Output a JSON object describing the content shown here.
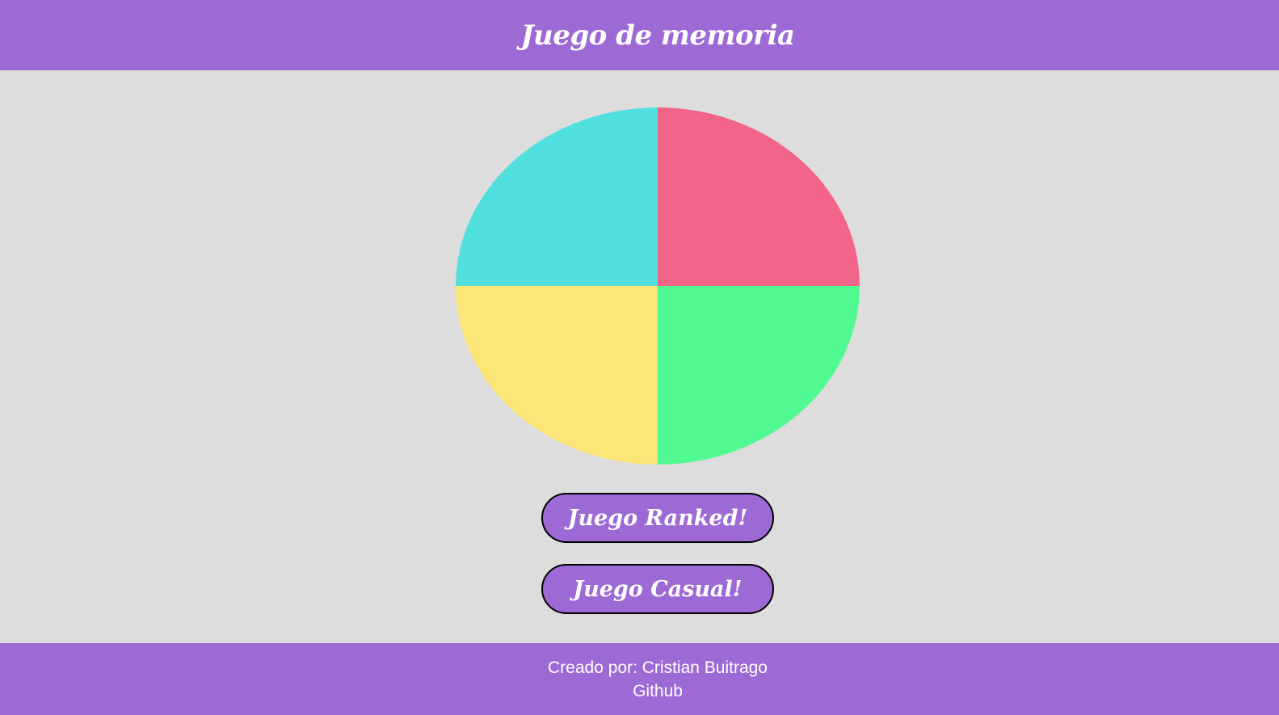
{
  "header": {
    "title": "Juego de memoria"
  },
  "board": {
    "quadrants": [
      {
        "position": "top-left",
        "color": "#52e0df"
      },
      {
        "position": "top-right",
        "color": "#f26588"
      },
      {
        "position": "bottom-left",
        "color": "#fce677"
      },
      {
        "position": "bottom-right",
        "color": "#50fa90"
      }
    ]
  },
  "buttons": {
    "ranked_label": "Juego Ranked!",
    "casual_label": "Juego Casual!"
  },
  "footer": {
    "credit": "Creado por: Cristian Buitrago",
    "github_label": "Github"
  },
  "colors": {
    "accent": "#9d69d4",
    "background": "#dddddd"
  }
}
